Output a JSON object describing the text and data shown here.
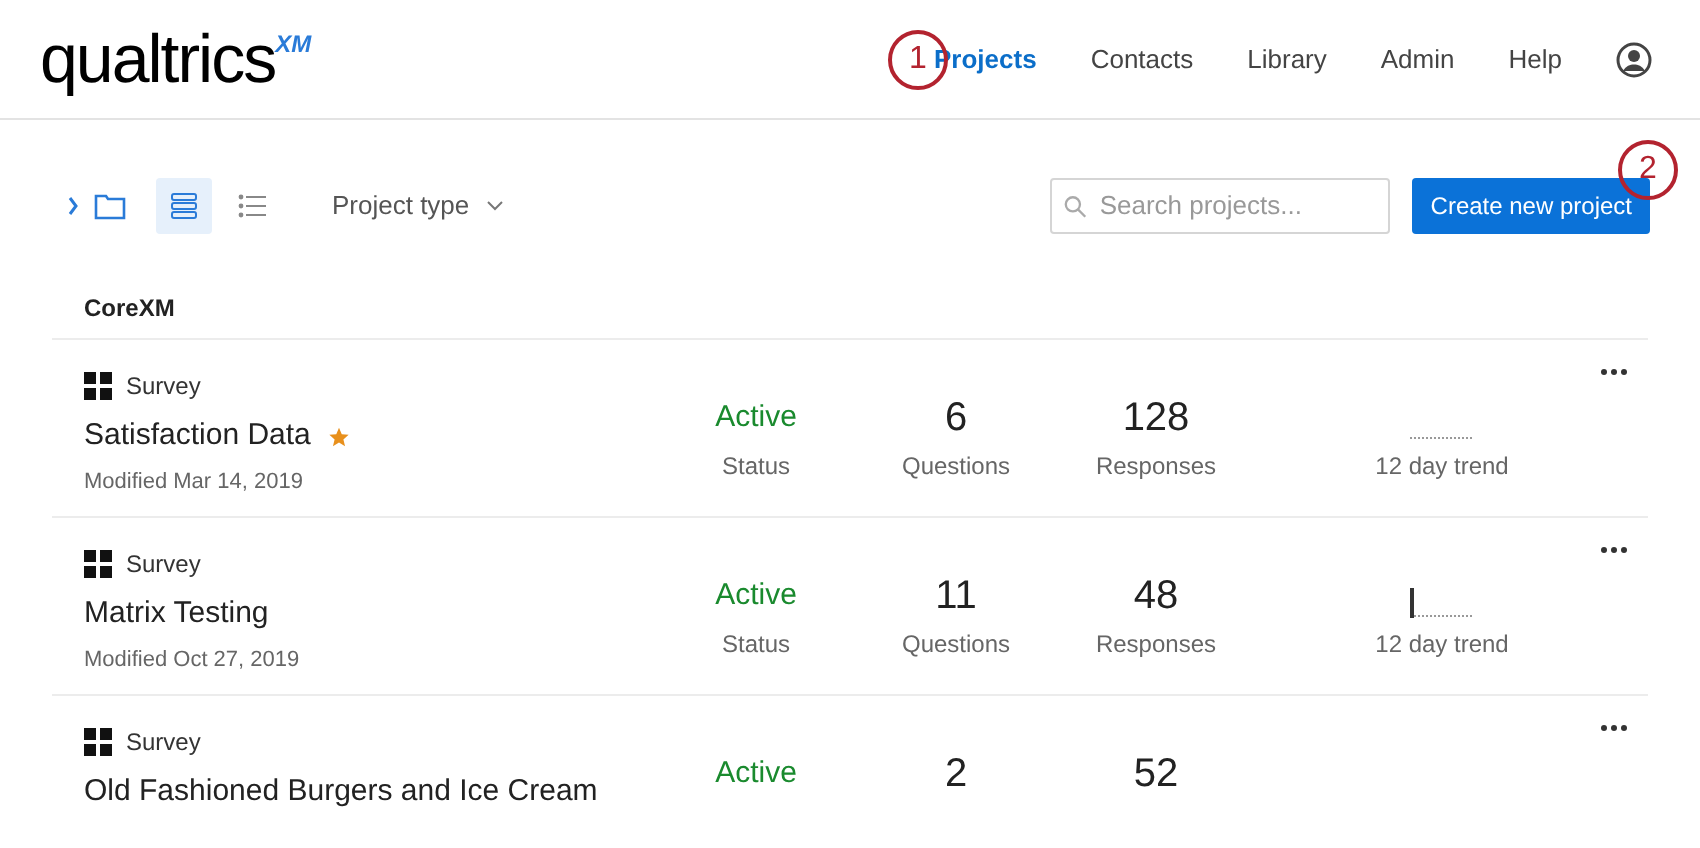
{
  "logo": {
    "text": "qualtrics",
    "mark": "XM"
  },
  "nav": [
    {
      "label": "Projects",
      "selected": true
    },
    {
      "label": "Contacts",
      "selected": false
    },
    {
      "label": "Library",
      "selected": false
    },
    {
      "label": "Admin",
      "selected": false
    },
    {
      "label": "Help",
      "selected": false
    }
  ],
  "callouts": [
    "1",
    "2"
  ],
  "toolbar": {
    "view_modes": [
      {
        "kind": "cards",
        "selected": true
      },
      {
        "kind": "list",
        "selected": false
      }
    ],
    "filter": "Project type",
    "search": {
      "placeholder": "Search projects..."
    },
    "create_button": "Create new project"
  },
  "section": "CoreXM",
  "projects": [
    {
      "type": "Survey",
      "name": "Satisfaction Data",
      "starred": true,
      "modified": "Modified Mar 14, 2019",
      "status": "Active",
      "status_label": "Status",
      "questions": "6",
      "questions_label": "Questions",
      "responses": "128",
      "responses_label": "Responses",
      "trend": {
        "kind": "flat"
      },
      "trend_label": "12 day trend"
    },
    {
      "type": "Survey",
      "name": "Matrix Testing",
      "starred": false,
      "modified": "Modified Oct 27, 2019",
      "status": "Active",
      "status_label": "Status",
      "questions": "11",
      "questions_label": "Questions",
      "responses": "48",
      "responses_label": "Responses",
      "trend": {
        "kind": "spike"
      },
      "trend_label": "12 day trend"
    },
    {
      "type": "Survey",
      "name": "Old Fashioned Burgers and Ice Cream",
      "starred": false,
      "status": "Active",
      "questions": "2",
      "responses": "52"
    }
  ]
}
